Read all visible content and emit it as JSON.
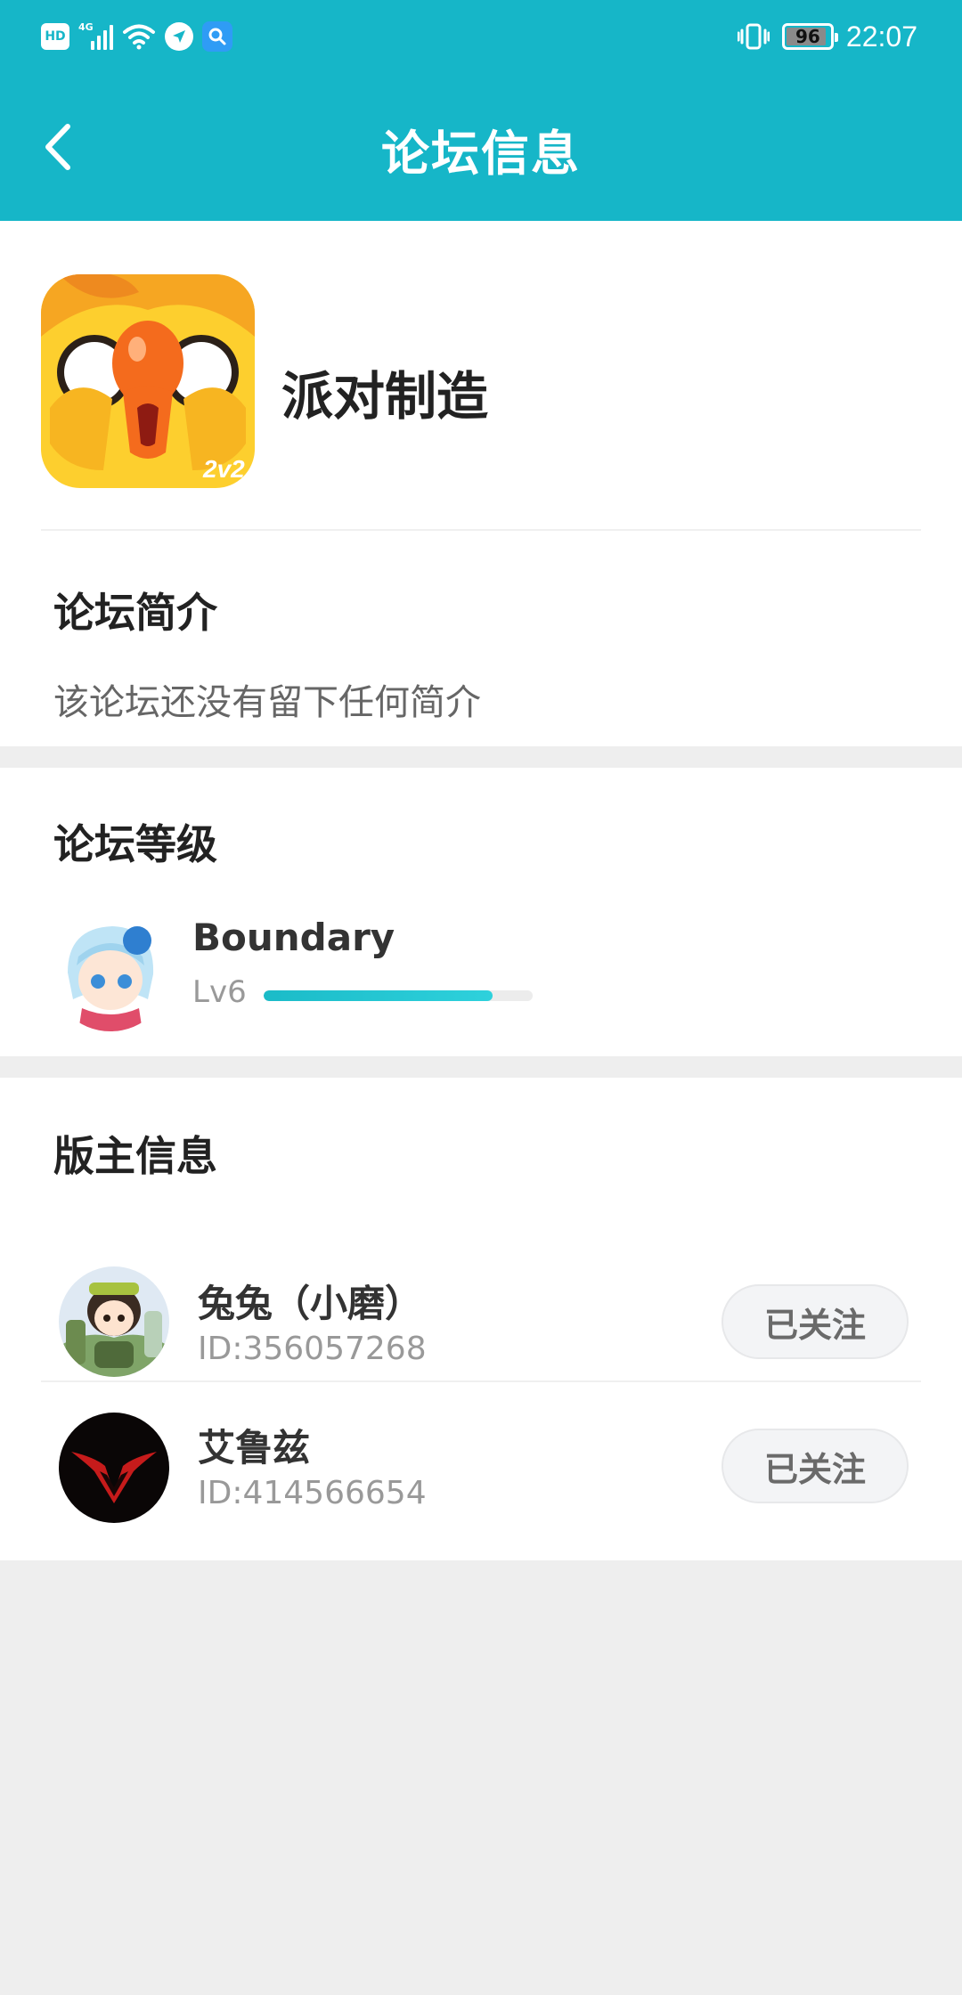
{
  "status_bar": {
    "hd": "HD",
    "network": "4G",
    "battery": "96",
    "time": "22:07"
  },
  "header": {
    "title": "论坛信息"
  },
  "forum": {
    "name": "派对制造",
    "icon_badge": "2v2"
  },
  "intro": {
    "title": "论坛简介",
    "text": "该论坛还没有留下任何简介"
  },
  "level": {
    "title": "论坛等级",
    "user_name": "Boundary",
    "level_label": "Lv6",
    "progress": 0.85
  },
  "moderators": {
    "title": "版主信息",
    "items": [
      {
        "name": "兔兔（小磨）",
        "id": "ID:356057268",
        "follow_label": "已关注"
      },
      {
        "name": "艾鲁兹",
        "id": "ID:414566654",
        "follow_label": "已关注"
      }
    ]
  },
  "colors": {
    "header": "#16b6c8",
    "accent": "#1bbbc8",
    "page_bg": "#eeeeee"
  }
}
